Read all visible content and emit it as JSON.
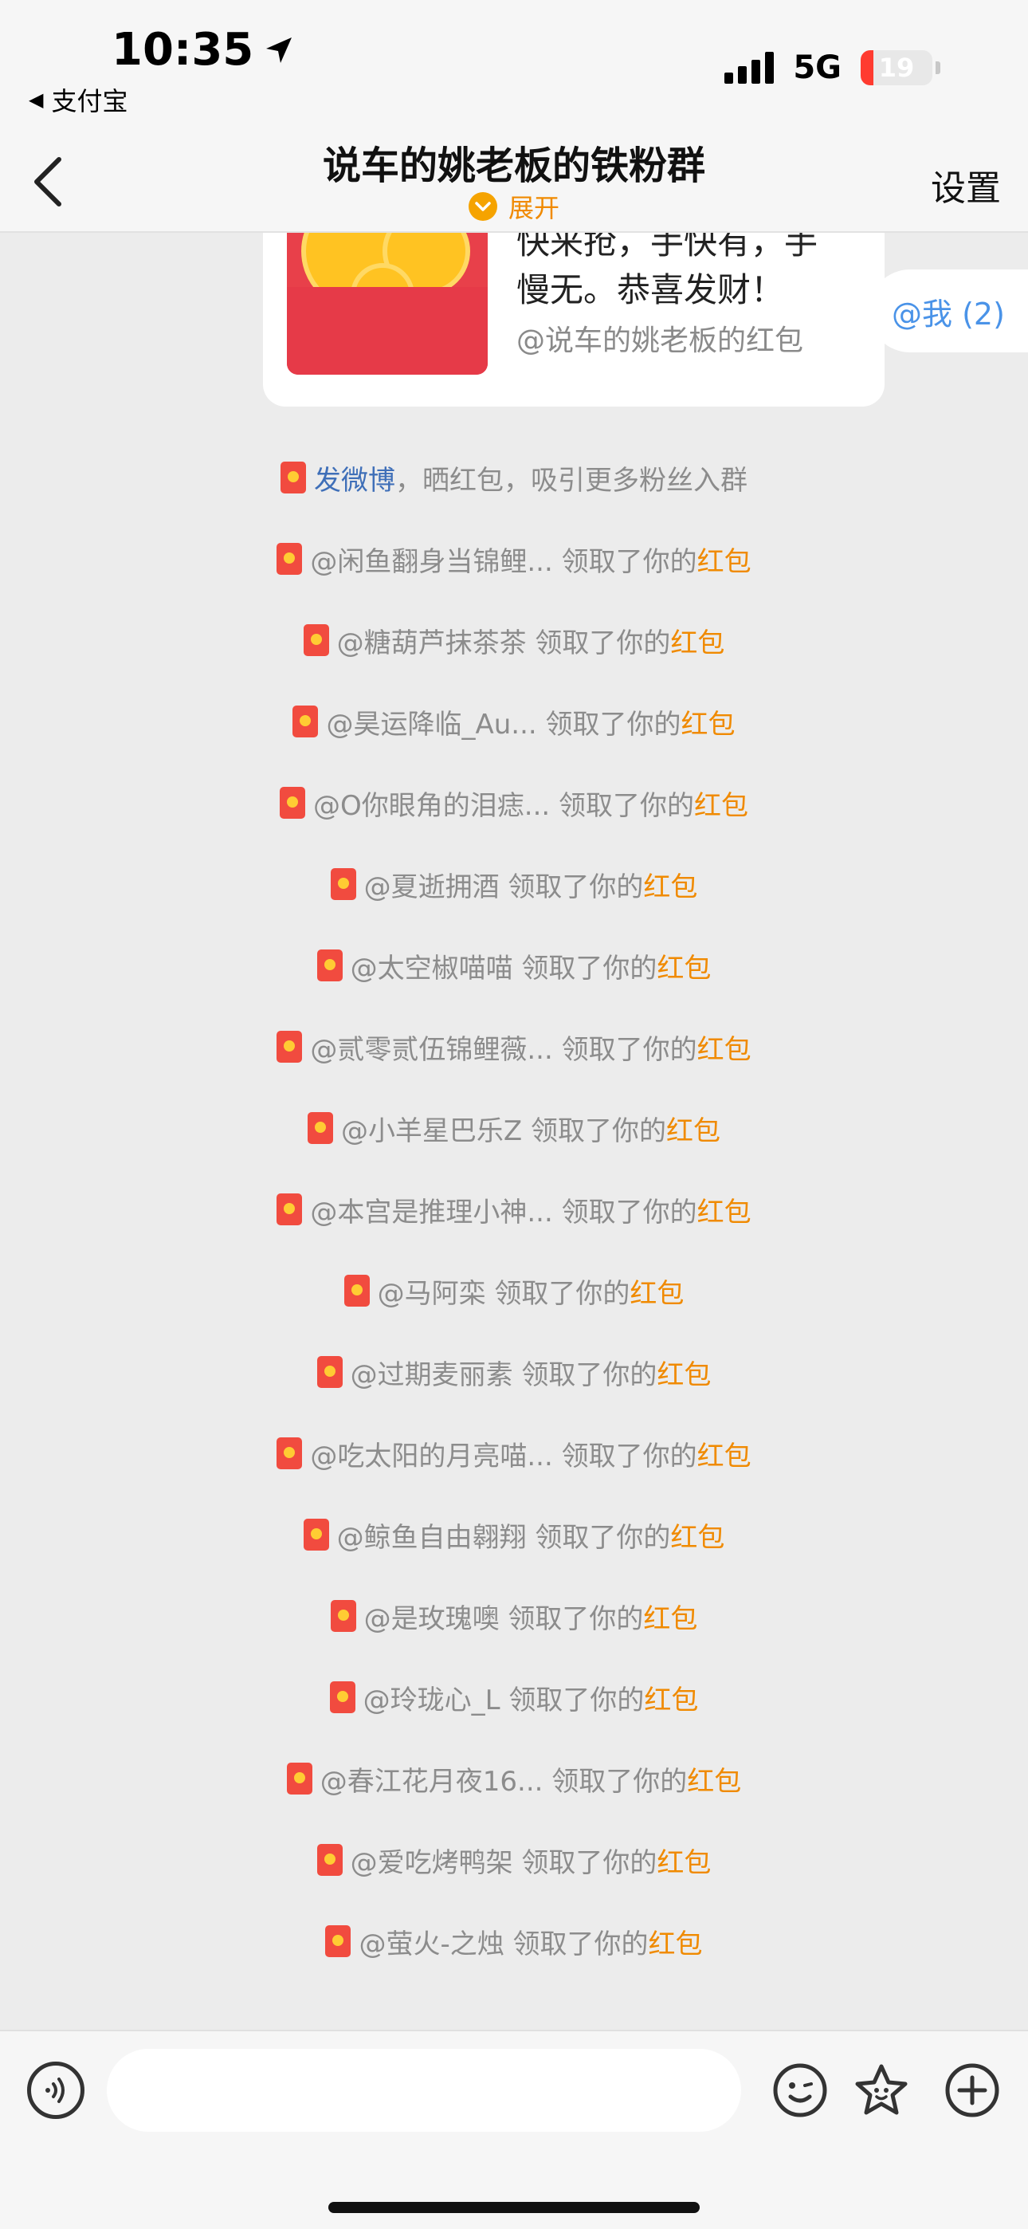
{
  "status_bar": {
    "time": "10:35",
    "back_app": "支付宝",
    "network": "5G",
    "battery_level": "19",
    "battery_fraction": 0.19
  },
  "nav": {
    "title": "说车的姚老板的铁粉群",
    "expand_label": "展开",
    "settings_label": "设置"
  },
  "packet_card": {
    "line1": "快来抢，手快有，手",
    "line2": "慢无。恭喜发财！",
    "source": "@说车的姚老板的红包"
  },
  "at_me": "@我 (2)",
  "share_notice": {
    "link": "发微博",
    "text": "，晒红包，吸引更多粉丝入群"
  },
  "claim_action": "领取了你的",
  "claim_link": "红包",
  "claims": [
    "@闲鱼翻身当锦鲤...",
    "@糖葫芦抹茶茶",
    "@昊运降临_Au...",
    "@O你眼角的泪痣...",
    "@夏逝拥酒",
    "@太空椒喵喵",
    "@贰零贰伍锦鲤薇...",
    "@小羊星巴乐Z",
    "@本宫是推理小神...",
    "@马阿栾",
    "@过期麦丽素",
    "@吃太阳的月亮喵...",
    "@鲸鱼自由翱翔",
    "@是玫瑰噢",
    "@玲珑心_L",
    "@春江花月夜16...",
    "@爱吃烤鸭架",
    "@萤火-之烛"
  ],
  "colors": {
    "accent_orange": "#f08a00",
    "link_blue": "#3f6fb8",
    "at_blue": "#4a93e8",
    "packet_red": "#e8404a"
  },
  "icons": {
    "voice": "voice-icon",
    "emoji": "emoji-icon",
    "sticker": "sticker-icon",
    "plus": "plus-icon"
  }
}
